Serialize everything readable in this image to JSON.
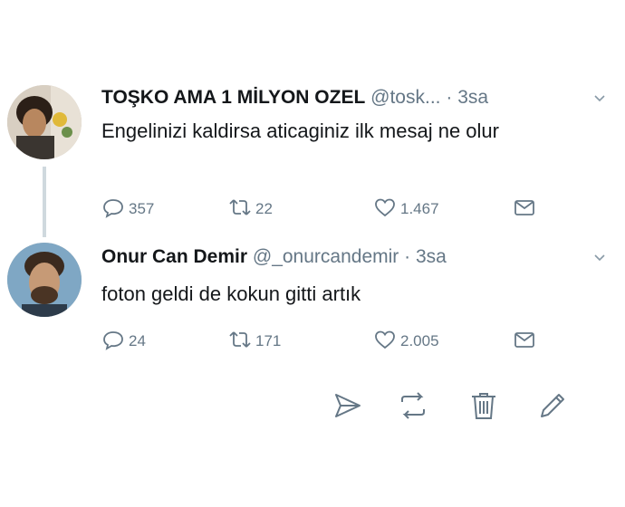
{
  "colors": {
    "text": "#14171a",
    "muted": "#657786",
    "thread_line": "#cfd9de"
  },
  "tweets": [
    {
      "name": "TOŞKO AMA 1 MİLYON OZEL",
      "handle": "@tosk...",
      "dot": "·",
      "time": "3sa",
      "text": "Engelinizi kaldirsa aticaginiz ilk mesaj ne olur",
      "replies": "357",
      "retweets": "22",
      "likes": "1.467"
    },
    {
      "name": "Onur Can Demir",
      "handle": "@_onurcandemir",
      "dot": "·",
      "time": "3sa",
      "text": "foton geldi de kokun gitti artık",
      "replies": "24",
      "retweets": "171",
      "likes": "2.005"
    }
  ],
  "icons": {
    "reply": "reply-icon",
    "retweet": "retweet-icon",
    "like": "heart-icon",
    "dm": "envelope-icon",
    "chevron": "chevron-down-icon",
    "send": "send-icon",
    "toolbar_retweet": "retweet-icon",
    "trash": "trash-icon",
    "edit": "pencil-icon"
  }
}
